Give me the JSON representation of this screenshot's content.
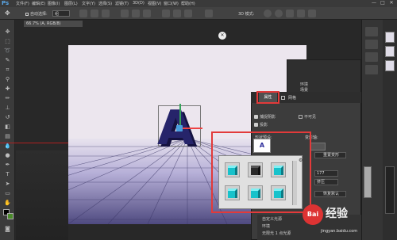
{
  "app": {
    "logo": "Ps",
    "menu": [
      "文件(F)",
      "编辑(E)",
      "图像(I)",
      "图层(L)",
      "文字(Y)",
      "选择(S)",
      "滤镜(T)",
      "3D(D)",
      "视图(V)",
      "窗口(W)",
      "帮助(H)"
    ],
    "window_controls": [
      "—",
      "□",
      "✕"
    ]
  },
  "options_bar": {
    "auto_select_label": "自动选择:",
    "auto_select_value": "组",
    "mode_label": "3D 模式:"
  },
  "document": {
    "tab_title": "66.7% (A, RGB/8)",
    "close_glyph": "✕"
  },
  "letter": "A",
  "panels": {
    "back_labels": [
      "环境",
      "场景",
      "当前视图",
      "无限光 1"
    ],
    "properties_tab": "属性",
    "mesh_tab": "网格",
    "catch_shadows": "捕捉阴影",
    "cast_shadows": "投影",
    "invisible": "不可见",
    "shape_preset_label": "形状预设:",
    "deform_axis_label": "变形轴:",
    "reset_deform": "重置变形",
    "extrude_value": "177",
    "extrude_label": "挤压",
    "reset_label": "恢复默认"
  },
  "layers": [
    "自定义光源",
    "环境",
    "无限光 1 点光源"
  ],
  "watermark": {
    "brand": "Bai",
    "name": "经验",
    "url": "jingyan.baidu.com"
  },
  "colors": {
    "accent_red": "#e23a3a",
    "cube_cyan": "#17c2cb"
  }
}
